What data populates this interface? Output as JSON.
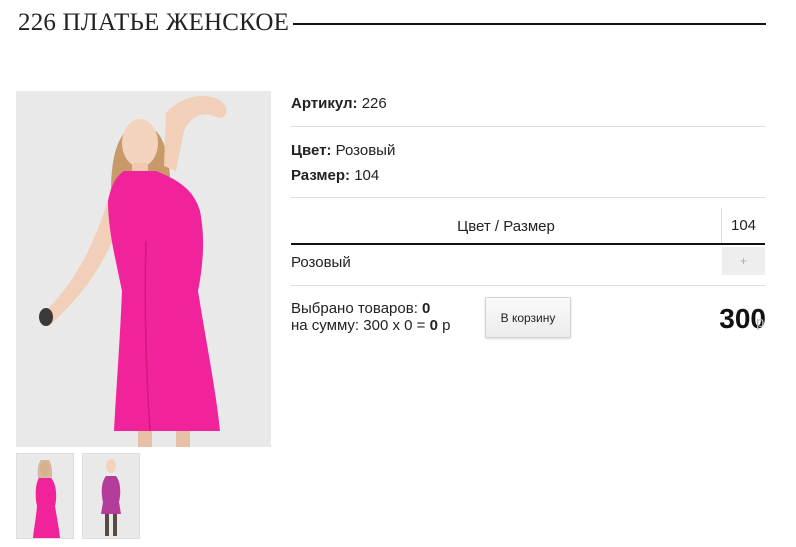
{
  "product": {
    "title": "226 ПЛАТЬЕ ЖЕНСКОЕ"
  },
  "details": {
    "article_label": "Артикул:",
    "article_value": "226",
    "color_label": "Цвет:",
    "color_value": "Розовый",
    "size_label": "Размер:",
    "size_value": "104"
  },
  "variant_table": {
    "header_label": "Цвет / Размер",
    "sizes": [
      "104"
    ],
    "rows": [
      {
        "color": "Розовый",
        "qty_button": "+"
      }
    ]
  },
  "summary": {
    "selected_label": "Выбрано товаров:",
    "selected_count": "0",
    "sum_label": "на сумму: 300 х 0 =",
    "sum_value": "0",
    "sum_currency": "р"
  },
  "cart_button": {
    "label": "В корзину"
  },
  "price": {
    "value": "300",
    "currency": "р"
  },
  "colors": {
    "dress": "#f0239a",
    "background": "#e9e9ea"
  }
}
